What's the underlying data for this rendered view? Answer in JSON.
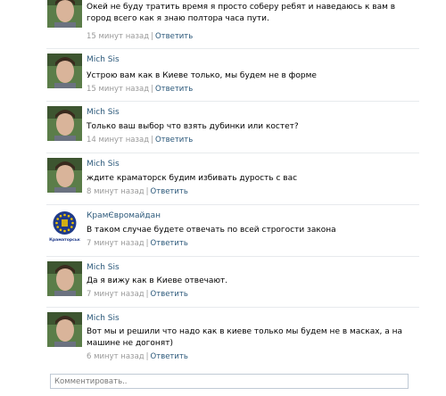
{
  "comments": [
    {
      "author": "",
      "avatar": "person-photo",
      "text": "Окей не буду тратить время я просто соберу ребят и наведаюсь к вам в город всего как я знаю полтора часа пути.",
      "time": "15 минут назад",
      "reply": "Ответить"
    },
    {
      "author": "Mich Sis",
      "avatar": "person-photo",
      "text": "Устрою вам как в Киеве только, мы будем не в форме",
      "time": "15 минут назад",
      "reply": "Ответить"
    },
    {
      "author": "Mich Sis",
      "avatar": "person-photo",
      "text": "Только ваш выбор что взять дубинки или костет?",
      "time": "14 минут назад",
      "reply": "Ответить"
    },
    {
      "author": "Mich Sis",
      "avatar": "person-photo",
      "text": "ждите краматорск будим избивать дурость с вас",
      "time": "8 минут назад",
      "reply": "Ответить"
    },
    {
      "author": "КрамЄвромайдан",
      "avatar": "eu-flag-logo",
      "avatar_caption": "Краматорськ",
      "text": "В таком случае будете отвечать по всей строгости закона",
      "time": "7 минут назад",
      "reply": "Ответить"
    },
    {
      "author": "Mich Sis",
      "avatar": "person-photo",
      "text": "Да я вижу как в Киеве отвечают.",
      "time": "7 минут назад",
      "reply": "Ответить"
    },
    {
      "author": "Mich Sis",
      "avatar": "person-photo",
      "text": "Вот мы и решили что надо как в киеве только мы будем не в масках, а на машине не догонят)",
      "time": "6 минут назад",
      "reply": "Ответить"
    }
  ],
  "composer": {
    "placeholder": "Комментировать.."
  },
  "colors": {
    "link": "#2b587a",
    "meta": "#999999",
    "eu_blue": "#1f3a8a",
    "eu_star": "#f2c400"
  }
}
